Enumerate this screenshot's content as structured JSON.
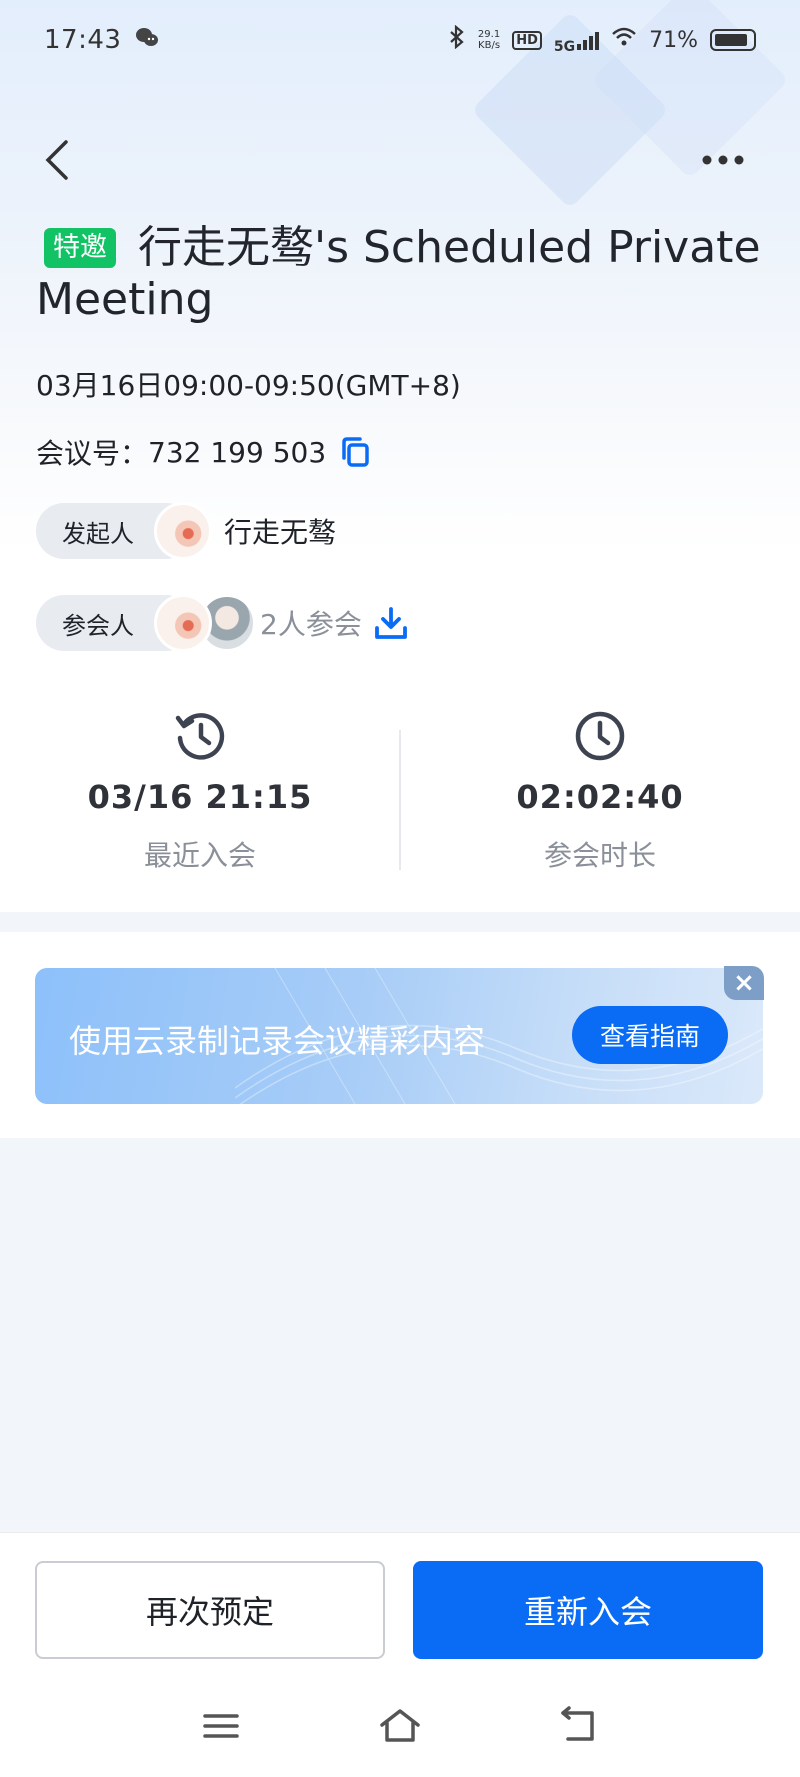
{
  "status_bar": {
    "time": "17:43",
    "net_speed_value": "29.1",
    "net_speed_unit": "KB/s",
    "hd_label": "HD",
    "network_label": "5G",
    "battery": "71%"
  },
  "meeting": {
    "tag": "特邀",
    "title": "行走无骜's Scheduled Private Meeting",
    "time_range": "03月16日09:00-09:50(GMT+8)",
    "id_label": "会议号：",
    "id_value": "732 199 503"
  },
  "host": {
    "label": "发起人",
    "name": "行走无骜"
  },
  "participants": {
    "label": "参会人",
    "count_text": "2人参会"
  },
  "stats": {
    "last_join_value": "03/16 21:15",
    "last_join_label": "最近入会",
    "duration_value": "02:02:40",
    "duration_label": "参会时长"
  },
  "banner": {
    "text": "使用云录制记录会议精彩内容",
    "button": "查看指南",
    "close": "×"
  },
  "actions": {
    "rebook": "再次预定",
    "rejoin": "重新入会"
  },
  "colors": {
    "accent": "#0a6cf5",
    "tag_green": "#12c366"
  }
}
